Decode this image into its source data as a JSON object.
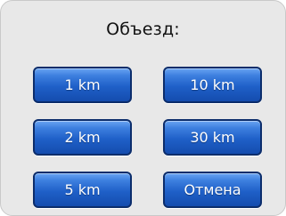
{
  "dialog": {
    "title": "Объезд:",
    "buttons": {
      "km1": "1 km",
      "km10": "10 km",
      "km2": "2 km",
      "km30": "30 km",
      "km5": "5 km",
      "cancel": "Отмена"
    }
  },
  "colors": {
    "background": "#e8e8e8",
    "button_fill": "#1f60c8",
    "button_border": "#0c2d6b",
    "button_text": "#ffffff"
  }
}
